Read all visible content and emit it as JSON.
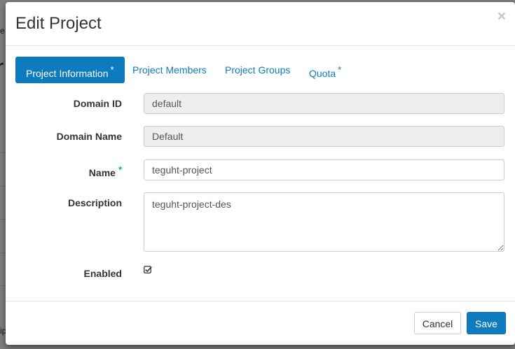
{
  "background": {
    "fragment_top": "e",
    "fragment_big": "r",
    "fragment_bottom": "ip"
  },
  "modal": {
    "title": "Edit Project",
    "close_glyph": "×"
  },
  "tabs": [
    {
      "label": "Project Information",
      "required": "*",
      "active": true
    },
    {
      "label": "Project Members",
      "required": ""
    },
    {
      "label": "Project Groups",
      "required": ""
    },
    {
      "label": "Quota",
      "required": "*"
    }
  ],
  "form": {
    "domain_id": {
      "label": "Domain ID",
      "value": "default"
    },
    "domain_name": {
      "label": "Domain Name",
      "value": "Default"
    },
    "name": {
      "label": "Name",
      "required": "*",
      "value": "teguht-project"
    },
    "description": {
      "label": "Description",
      "value": "teguht-project-des"
    },
    "enabled": {
      "label": "Enabled",
      "checked": true,
      "icon": "checkbox-checked-icon"
    }
  },
  "footer": {
    "cancel_label": "Cancel",
    "save_label": "Save"
  },
  "colors": {
    "accent": "#0d7bbd",
    "required_star": "#0d9bd1",
    "readonly_bg": "#eeeeee"
  }
}
